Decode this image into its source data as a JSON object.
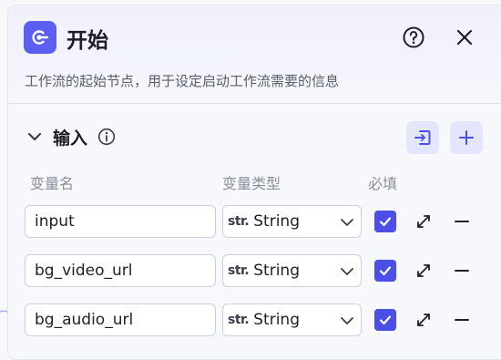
{
  "header": {
    "title": "开始",
    "description": "工作流的起始节点，用于设定启动工作流需要的信息"
  },
  "section": {
    "title": "输入"
  },
  "columns": {
    "name": "变量名",
    "type": "变量类型",
    "required": "必填"
  },
  "rows": [
    {
      "name": "input",
      "type_prefix": "str.",
      "type": "String",
      "required": true
    },
    {
      "name": "bg_video_url",
      "type_prefix": "str.",
      "type": "String",
      "required": true
    },
    {
      "name": "bg_audio_url",
      "type_prefix": "str.",
      "type": "String",
      "required": true
    }
  ],
  "colors": {
    "accent": "#5b5ff0",
    "checkbox": "#4b4fe8",
    "button_bg": "#e4e6fd"
  },
  "icons": {
    "node": "start-node-icon",
    "help": "help-circle-icon",
    "close": "close-icon",
    "collapse": "chevron-down-icon",
    "info": "info-icon",
    "import": "import-icon",
    "add": "plus-icon",
    "expand": "expand-icon",
    "remove": "minus-icon"
  }
}
